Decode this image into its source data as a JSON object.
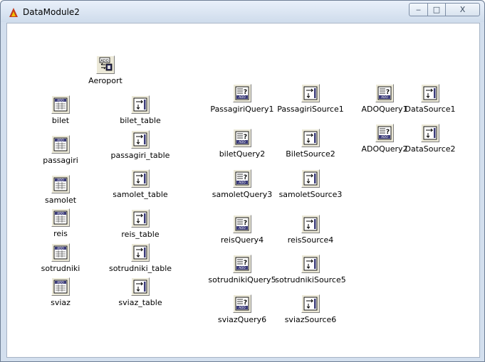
{
  "window": {
    "title": "DataModule2",
    "minimize": "‒",
    "maximize": "□",
    "close": "X"
  },
  "components": [
    {
      "name": "Aeroport",
      "type": "ado-connection"
    },
    {
      "name": "bilet",
      "type": "ado-table"
    },
    {
      "name": "passagiri",
      "type": "ado-table"
    },
    {
      "name": "samolet",
      "type": "ado-table"
    },
    {
      "name": "reis",
      "type": "ado-table"
    },
    {
      "name": "sotrudniki",
      "type": "ado-table"
    },
    {
      "name": "sviaz",
      "type": "ado-table"
    },
    {
      "name": "bilet_table",
      "type": "data-source"
    },
    {
      "name": "passagiri_table",
      "type": "data-source"
    },
    {
      "name": "samolet_table",
      "type": "data-source"
    },
    {
      "name": "reis_table",
      "type": "data-source"
    },
    {
      "name": "sotrudniki_table",
      "type": "data-source"
    },
    {
      "name": "sviaz_table",
      "type": "data-source"
    },
    {
      "name": "PassagiriQuery1",
      "type": "ado-query"
    },
    {
      "name": "PassagiriSource1",
      "type": "data-source"
    },
    {
      "name": "biletQuery2",
      "type": "ado-query"
    },
    {
      "name": "BiletSource2",
      "type": "data-source"
    },
    {
      "name": "samoletQuery3",
      "type": "ado-query"
    },
    {
      "name": "samoletSource3",
      "type": "data-source"
    },
    {
      "name": "reisQuery4",
      "type": "ado-query"
    },
    {
      "name": "reisSource4",
      "type": "data-source"
    },
    {
      "name": "sotrudnikiQuery5",
      "type": "ado-query"
    },
    {
      "name": "sotrudnikiSource5",
      "type": "data-source"
    },
    {
      "name": "sviazQuery6",
      "type": "ado-query"
    },
    {
      "name": "sviazSource6",
      "type": "data-source"
    },
    {
      "name": "ADOQuery1",
      "type": "ado-query"
    },
    {
      "name": "DataSource1",
      "type": "data-source"
    },
    {
      "name": "ADOQuery2",
      "type": "ado-query"
    },
    {
      "name": "DataSource2",
      "type": "data-source"
    }
  ]
}
